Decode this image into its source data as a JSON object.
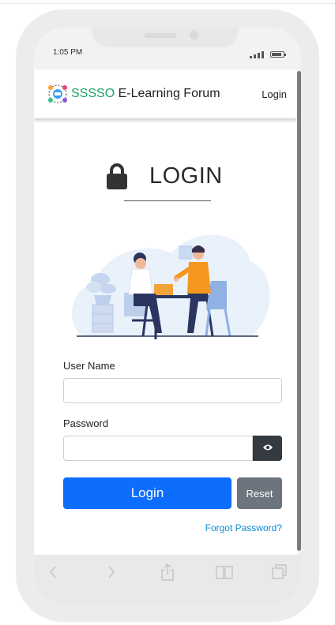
{
  "status_bar": {
    "time": "1:05 PM"
  },
  "navbar": {
    "brand_accent": "SSSSO",
    "brand_rest": " E-Learning Forum",
    "login_link": "Login"
  },
  "page": {
    "title": "LOGIN"
  },
  "form": {
    "username_label": "User Name",
    "username_value": "",
    "password_label": "Password",
    "password_value": "",
    "login_button": "Login",
    "reset_button": "Reset",
    "forgot_link": "Forgot Password?"
  },
  "icons": {
    "lock": "lock-icon",
    "eye": "eye-icon",
    "back": "chevron-left-icon",
    "forward": "chevron-right-icon",
    "share": "share-icon",
    "bookmarks": "book-icon",
    "tabs": "tabs-icon"
  },
  "colors": {
    "brand_accent": "#1aa36b",
    "primary": "#0d6efd",
    "secondary": "#6c757d",
    "dark": "#343a40",
    "link": "#0a8bd8"
  }
}
